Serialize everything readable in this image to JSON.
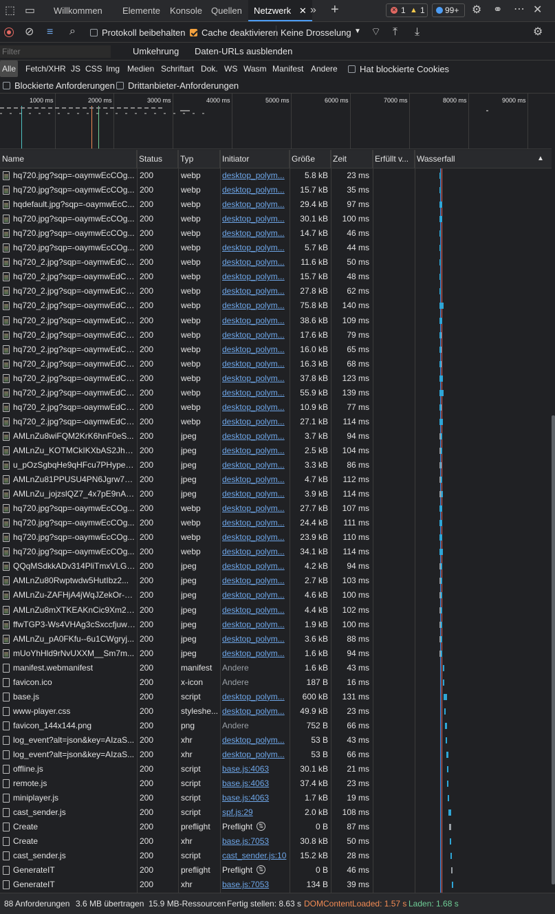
{
  "tabs": {
    "welcome": "Willkommen",
    "elements": "Elemente",
    "console": "Konsole",
    "sources": "Quellen",
    "network": "Netzwerk",
    "errors": "1",
    "warnings": "1",
    "issues": "99+"
  },
  "toolbar": {
    "preserve_log": "Protokoll beibehalten",
    "disable_cache": "Cache deaktivieren",
    "throttling": "Keine Drosselung"
  },
  "filterbar": {
    "placeholder": "Filter",
    "invert": "Umkehrung",
    "hide_data_urls": "Daten-URLs ausblenden"
  },
  "types": [
    "Alle",
    "Fetch/XHR",
    "JS",
    "CSS",
    "Img",
    "Medien",
    "Schriftart",
    "Dok.",
    "WS",
    "Wasm",
    "Manifest",
    "Andere"
  ],
  "blocked_cookies": "Hat blockierte Cookies",
  "blocked_requests": "Blockierte Anforderungen",
  "third_party": "Drittanbieter-Anforderungen",
  "overview_ticks": [
    "1000 ms",
    "2000 ms",
    "3000 ms",
    "4000 ms",
    "5000 ms",
    "6000 ms",
    "7000 ms",
    "8000 ms",
    "9000 ms"
  ],
  "columns": {
    "name": "Name",
    "status": "Status",
    "type": "Typ",
    "initiator": "Initiator",
    "size": "Größe",
    "time": "Zeit",
    "fulfilled": "Erfüllt v...",
    "waterfall": "Wasserfall"
  },
  "rows": [
    {
      "name": "hq720.jpg?sqp=-oaymwEcCOg...",
      "status": "200",
      "type": "webp",
      "initiator": "desktop_polym...",
      "init_kind": "link",
      "size": "5.8 kB",
      "time": "23 ms",
      "icon": "img"
    },
    {
      "name": "hq720.jpg?sqp=-oaymwEcCOg...",
      "status": "200",
      "type": "webp",
      "initiator": "desktop_polym...",
      "init_kind": "link",
      "size": "15.7 kB",
      "time": "35 ms",
      "icon": "img"
    },
    {
      "name": "hqdefault.jpg?sqp=-oaymwEcC...",
      "status": "200",
      "type": "webp",
      "initiator": "desktop_polym...",
      "init_kind": "link",
      "size": "29.4 kB",
      "time": "97 ms",
      "icon": "img"
    },
    {
      "name": "hq720.jpg?sqp=-oaymwEcCOg...",
      "status": "200",
      "type": "webp",
      "initiator": "desktop_polym...",
      "init_kind": "link",
      "size": "30.1 kB",
      "time": "100 ms",
      "icon": "img"
    },
    {
      "name": "hq720.jpg?sqp=-oaymwEcCOg...",
      "status": "200",
      "type": "webp",
      "initiator": "desktop_polym...",
      "init_kind": "link",
      "size": "14.7 kB",
      "time": "46 ms",
      "icon": "img"
    },
    {
      "name": "hq720.jpg?sqp=-oaymwEcCOg...",
      "status": "200",
      "type": "webp",
      "initiator": "desktop_polym...",
      "init_kind": "link",
      "size": "5.7 kB",
      "time": "44 ms",
      "icon": "img"
    },
    {
      "name": "hq720_2.jpg?sqp=-oaymwEdCJ...",
      "status": "200",
      "type": "webp",
      "initiator": "desktop_polym...",
      "init_kind": "link",
      "size": "11.6 kB",
      "time": "50 ms",
      "icon": "img"
    },
    {
      "name": "hq720_2.jpg?sqp=-oaymwEdCJ...",
      "status": "200",
      "type": "webp",
      "initiator": "desktop_polym...",
      "init_kind": "link",
      "size": "15.7 kB",
      "time": "48 ms",
      "icon": "img"
    },
    {
      "name": "hq720_2.jpg?sqp=-oaymwEdCJ...",
      "status": "200",
      "type": "webp",
      "initiator": "desktop_polym...",
      "init_kind": "link",
      "size": "27.8 kB",
      "time": "62 ms",
      "icon": "img"
    },
    {
      "name": "hq720_2.jpg?sqp=-oaymwEdCJ...",
      "status": "200",
      "type": "webp",
      "initiator": "desktop_polym...",
      "init_kind": "link",
      "size": "75.8 kB",
      "time": "140 ms",
      "icon": "img"
    },
    {
      "name": "hq720_2.jpg?sqp=-oaymwEdCJ...",
      "status": "200",
      "type": "webp",
      "initiator": "desktop_polym...",
      "init_kind": "link",
      "size": "38.6 kB",
      "time": "109 ms",
      "icon": "img"
    },
    {
      "name": "hq720_2.jpg?sqp=-oaymwEdCJ...",
      "status": "200",
      "type": "webp",
      "initiator": "desktop_polym...",
      "init_kind": "link",
      "size": "17.6 kB",
      "time": "79 ms",
      "icon": "img"
    },
    {
      "name": "hq720_2.jpg?sqp=-oaymwEdCJ...",
      "status": "200",
      "type": "webp",
      "initiator": "desktop_polym...",
      "init_kind": "link",
      "size": "16.0 kB",
      "time": "65 ms",
      "icon": "img"
    },
    {
      "name": "hq720_2.jpg?sqp=-oaymwEdCJ...",
      "status": "200",
      "type": "webp",
      "initiator": "desktop_polym...",
      "init_kind": "link",
      "size": "16.3 kB",
      "time": "68 ms",
      "icon": "img"
    },
    {
      "name": "hq720_2.jpg?sqp=-oaymwEdCJ...",
      "status": "200",
      "type": "webp",
      "initiator": "desktop_polym...",
      "init_kind": "link",
      "size": "37.8 kB",
      "time": "123 ms",
      "icon": "img"
    },
    {
      "name": "hq720_2.jpg?sqp=-oaymwEdCJ...",
      "status": "200",
      "type": "webp",
      "initiator": "desktop_polym...",
      "init_kind": "link",
      "size": "55.9 kB",
      "time": "139 ms",
      "icon": "img"
    },
    {
      "name": "hq720_2.jpg?sqp=-oaymwEdCJ...",
      "status": "200",
      "type": "webp",
      "initiator": "desktop_polym...",
      "init_kind": "link",
      "size": "10.9 kB",
      "time": "77 ms",
      "icon": "img"
    },
    {
      "name": "hq720_2.jpg?sqp=-oaymwEdCJ...",
      "status": "200",
      "type": "webp",
      "initiator": "desktop_polym...",
      "init_kind": "link",
      "size": "27.1 kB",
      "time": "114 ms",
      "icon": "img"
    },
    {
      "name": "AMLnZu8wiFQM2KrK6hnF0eS...",
      "status": "200",
      "type": "jpeg",
      "initiator": "desktop_polym...",
      "init_kind": "link",
      "size": "3.7 kB",
      "time": "94 ms",
      "icon": "img"
    },
    {
      "name": "AMLnZu_KOTMCkIKXbAS2Jh7y...",
      "status": "200",
      "type": "jpeg",
      "initiator": "desktop_polym...",
      "init_kind": "link",
      "size": "2.5 kB",
      "time": "104 ms",
      "icon": "img"
    },
    {
      "name": "u_pOzSgbqHe9qHFcu7PHypeS...",
      "status": "200",
      "type": "jpeg",
      "initiator": "desktop_polym...",
      "init_kind": "link",
      "size": "3.3 kB",
      "time": "86 ms",
      "icon": "img"
    },
    {
      "name": "AMLnZu81PPUSU4PN6Jgrw7Br...",
      "status": "200",
      "type": "jpeg",
      "initiator": "desktop_polym...",
      "init_kind": "link",
      "size": "4.7 kB",
      "time": "112 ms",
      "icon": "img"
    },
    {
      "name": "AMLnZu_jojzslQZ7_4x7pE9nAe...",
      "status": "200",
      "type": "jpeg",
      "initiator": "desktop_polym...",
      "init_kind": "link",
      "size": "3.9 kB",
      "time": "114 ms",
      "icon": "img"
    },
    {
      "name": "hq720.jpg?sqp=-oaymwEcCOg...",
      "status": "200",
      "type": "webp",
      "initiator": "desktop_polym...",
      "init_kind": "link",
      "size": "27.7 kB",
      "time": "107 ms",
      "icon": "img"
    },
    {
      "name": "hq720.jpg?sqp=-oaymwEcCOg...",
      "status": "200",
      "type": "webp",
      "initiator": "desktop_polym...",
      "init_kind": "link",
      "size": "24.4 kB",
      "time": "111 ms",
      "icon": "img"
    },
    {
      "name": "hq720.jpg?sqp=-oaymwEcCOg...",
      "status": "200",
      "type": "webp",
      "initiator": "desktop_polym...",
      "init_kind": "link",
      "size": "23.9 kB",
      "time": "110 ms",
      "icon": "img"
    },
    {
      "name": "hq720.jpg?sqp=-oaymwEcCOg...",
      "status": "200",
      "type": "webp",
      "initiator": "desktop_polym...",
      "init_kind": "link",
      "size": "34.1 kB",
      "time": "114 ms",
      "icon": "img"
    },
    {
      "name": "QQqMSdkkADv314PliTmxVLGS...",
      "status": "200",
      "type": "jpeg",
      "initiator": "desktop_polym...",
      "init_kind": "link",
      "size": "4.2 kB",
      "time": "94 ms",
      "icon": "img"
    },
    {
      "name": "AMLnZu80Rwptwdw5HutIbz2...",
      "status": "200",
      "type": "jpeg",
      "initiator": "desktop_polym...",
      "init_kind": "link",
      "size": "2.7 kB",
      "time": "103 ms",
      "icon": "img"
    },
    {
      "name": "AMLnZu-ZAFHjA4jWqJZekOr-S...",
      "status": "200",
      "type": "jpeg",
      "initiator": "desktop_polym...",
      "init_kind": "link",
      "size": "4.6 kB",
      "time": "100 ms",
      "icon": "img"
    },
    {
      "name": "AMLnZu8mXTKEAKnCic9Xm20...",
      "status": "200",
      "type": "jpeg",
      "initiator": "desktop_polym...",
      "init_kind": "link",
      "size": "4.4 kB",
      "time": "102 ms",
      "icon": "img"
    },
    {
      "name": "ffwTGP3-Ws4VHAg3cSxccfjuwX...",
      "status": "200",
      "type": "jpeg",
      "initiator": "desktop_polym...",
      "init_kind": "link",
      "size": "1.9 kB",
      "time": "100 ms",
      "icon": "img"
    },
    {
      "name": "AMLnZu_pA0FKfu--6u1CWgryj...",
      "status": "200",
      "type": "jpeg",
      "initiator": "desktop_polym...",
      "init_kind": "link",
      "size": "3.6 kB",
      "time": "88 ms",
      "icon": "img"
    },
    {
      "name": "mUoYhHld9rNvUXXM__Sm7m...",
      "status": "200",
      "type": "jpeg",
      "initiator": "desktop_polym...",
      "init_kind": "link",
      "size": "1.6 kB",
      "time": "94 ms",
      "icon": "img"
    },
    {
      "name": "manifest.webmanifest",
      "status": "200",
      "type": "manifest",
      "initiator": "Andere",
      "init_kind": "muted",
      "size": "1.6 kB",
      "time": "43 ms",
      "icon": "file"
    },
    {
      "name": "favicon.ico",
      "status": "200",
      "type": "x-icon",
      "initiator": "Andere",
      "init_kind": "muted",
      "size": "187 B",
      "time": "16 ms",
      "icon": "file"
    },
    {
      "name": "base.js",
      "status": "200",
      "type": "script",
      "initiator": "desktop_polym...",
      "init_kind": "link",
      "size": "600 kB",
      "time": "131 ms",
      "icon": "file"
    },
    {
      "name": "www-player.css",
      "status": "200",
      "type": "styleshe...",
      "initiator": "desktop_polym...",
      "init_kind": "link",
      "size": "49.9 kB",
      "time": "23 ms",
      "icon": "file"
    },
    {
      "name": "favicon_144x144.png",
      "status": "200",
      "type": "png",
      "initiator": "Andere",
      "init_kind": "muted",
      "size": "752 B",
      "time": "66 ms",
      "icon": "file"
    },
    {
      "name": "log_event?alt=json&key=AIzaS...",
      "status": "200",
      "type": "xhr",
      "initiator": "desktop_polym...",
      "init_kind": "link",
      "size": "53 B",
      "time": "43 ms",
      "icon": "file"
    },
    {
      "name": "log_event?alt=json&key=AIzaS...",
      "status": "200",
      "type": "xhr",
      "initiator": "desktop_polym...",
      "init_kind": "link",
      "size": "53 B",
      "time": "66 ms",
      "icon": "file"
    },
    {
      "name": "offline.js",
      "status": "200",
      "type": "script",
      "initiator": "base.js:4063",
      "init_kind": "link",
      "size": "30.1 kB",
      "time": "21 ms",
      "icon": "file"
    },
    {
      "name": "remote.js",
      "status": "200",
      "type": "script",
      "initiator": "base.js:4063",
      "init_kind": "link",
      "size": "37.4 kB",
      "time": "23 ms",
      "icon": "file"
    },
    {
      "name": "miniplayer.js",
      "status": "200",
      "type": "script",
      "initiator": "base.js:4063",
      "init_kind": "link",
      "size": "1.7 kB",
      "time": "19 ms",
      "icon": "file"
    },
    {
      "name": "cast_sender.js",
      "status": "200",
      "type": "script",
      "initiator": "spf.js:29",
      "init_kind": "link",
      "size": "2.0 kB",
      "time": "108 ms",
      "icon": "file"
    },
    {
      "name": "Create",
      "status": "200",
      "type": "preflight",
      "initiator": "Preflight",
      "init_kind": "preflight",
      "size": "0 B",
      "time": "87 ms",
      "icon": "file"
    },
    {
      "name": "Create",
      "status": "200",
      "type": "xhr",
      "initiator": "base.js:7053",
      "init_kind": "link",
      "size": "30.8 kB",
      "time": "50 ms",
      "icon": "file"
    },
    {
      "name": "cast_sender.js",
      "status": "200",
      "type": "script",
      "initiator": "cast_sender.js:10",
      "init_kind": "link",
      "size": "15.2 kB",
      "time": "28 ms",
      "icon": "file"
    },
    {
      "name": "GenerateIT",
      "status": "200",
      "type": "preflight",
      "initiator": "Preflight",
      "init_kind": "preflight",
      "size": "0 B",
      "time": "46 ms",
      "icon": "file"
    },
    {
      "name": "GenerateIT",
      "status": "200",
      "type": "xhr",
      "initiator": "base.js:7053",
      "init_kind": "link",
      "size": "134 B",
      "time": "39 ms",
      "icon": "file"
    }
  ],
  "status": {
    "requests": "88 Anforderungen",
    "transferred": "3.6 MB übertragen",
    "resources": "15.9 MB-Ressourcen",
    "finish": "Fertig stellen: 8.63 s",
    "dcl": "DOMContentLoaded: 1.57 s",
    "load": "Laden: 1.68 s"
  },
  "colors": {
    "dcl": "#f28b54",
    "load": "#6fcf97",
    "accent": "#4d9df5",
    "link": "#6ea6e8"
  }
}
